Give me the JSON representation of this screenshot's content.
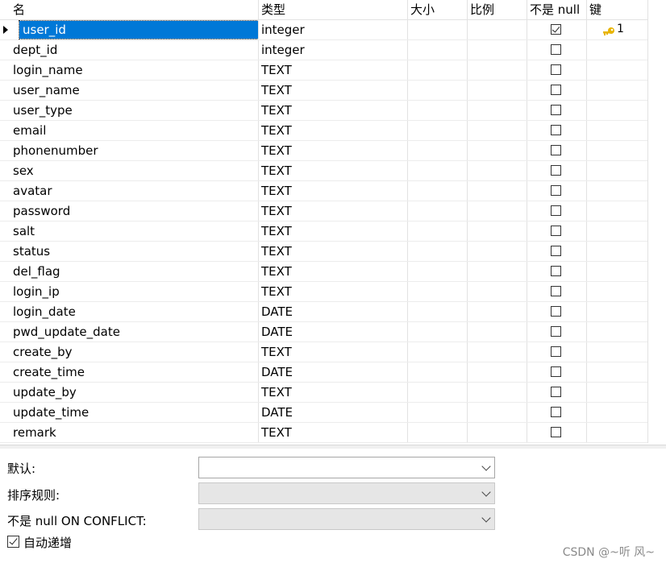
{
  "columns": [
    "名",
    "类型",
    "大小",
    "比例",
    "不是 null",
    "键"
  ],
  "rows": [
    {
      "name": "user_id",
      "type": "integer",
      "notnull": true,
      "key": "1"
    },
    {
      "name": "dept_id",
      "type": "integer",
      "notnull": false,
      "key": ""
    },
    {
      "name": "login_name",
      "type": "TEXT",
      "notnull": false,
      "key": ""
    },
    {
      "name": "user_name",
      "type": "TEXT",
      "notnull": false,
      "key": ""
    },
    {
      "name": "user_type",
      "type": "TEXT",
      "notnull": false,
      "key": ""
    },
    {
      "name": "email",
      "type": "TEXT",
      "notnull": false,
      "key": ""
    },
    {
      "name": "phonenumber",
      "type": "TEXT",
      "notnull": false,
      "key": ""
    },
    {
      "name": "sex",
      "type": "TEXT",
      "notnull": false,
      "key": ""
    },
    {
      "name": "avatar",
      "type": "TEXT",
      "notnull": false,
      "key": ""
    },
    {
      "name": "password",
      "type": "TEXT",
      "notnull": false,
      "key": ""
    },
    {
      "name": "salt",
      "type": "TEXT",
      "notnull": false,
      "key": ""
    },
    {
      "name": "status",
      "type": "TEXT",
      "notnull": false,
      "key": ""
    },
    {
      "name": "del_flag",
      "type": "TEXT",
      "notnull": false,
      "key": ""
    },
    {
      "name": "login_ip",
      "type": "TEXT",
      "notnull": false,
      "key": ""
    },
    {
      "name": "login_date",
      "type": "DATE",
      "notnull": false,
      "key": ""
    },
    {
      "name": "pwd_update_date",
      "type": "DATE",
      "notnull": false,
      "key": ""
    },
    {
      "name": "create_by",
      "type": "TEXT",
      "notnull": false,
      "key": ""
    },
    {
      "name": "create_time",
      "type": "DATE",
      "notnull": false,
      "key": ""
    },
    {
      "name": "update_by",
      "type": "TEXT",
      "notnull": false,
      "key": ""
    },
    {
      "name": "update_time",
      "type": "DATE",
      "notnull": false,
      "key": ""
    },
    {
      "name": "remark",
      "type": "TEXT",
      "notnull": false,
      "key": ""
    }
  ],
  "selected_row": 0,
  "key_icon": "key-icon",
  "form": {
    "default_label": "默认:",
    "default_value": "",
    "collation_label": "排序规则:",
    "collation_value": "",
    "notnull_conflict_label": "不是 null ON CONFLICT:",
    "notnull_conflict_value": "",
    "autoincrement_label": "自动递增",
    "autoincrement_checked": true
  },
  "watermark": "CSDN @~听 风~",
  "colors": {
    "selection": "#0078d7",
    "key": "#e8b400"
  }
}
